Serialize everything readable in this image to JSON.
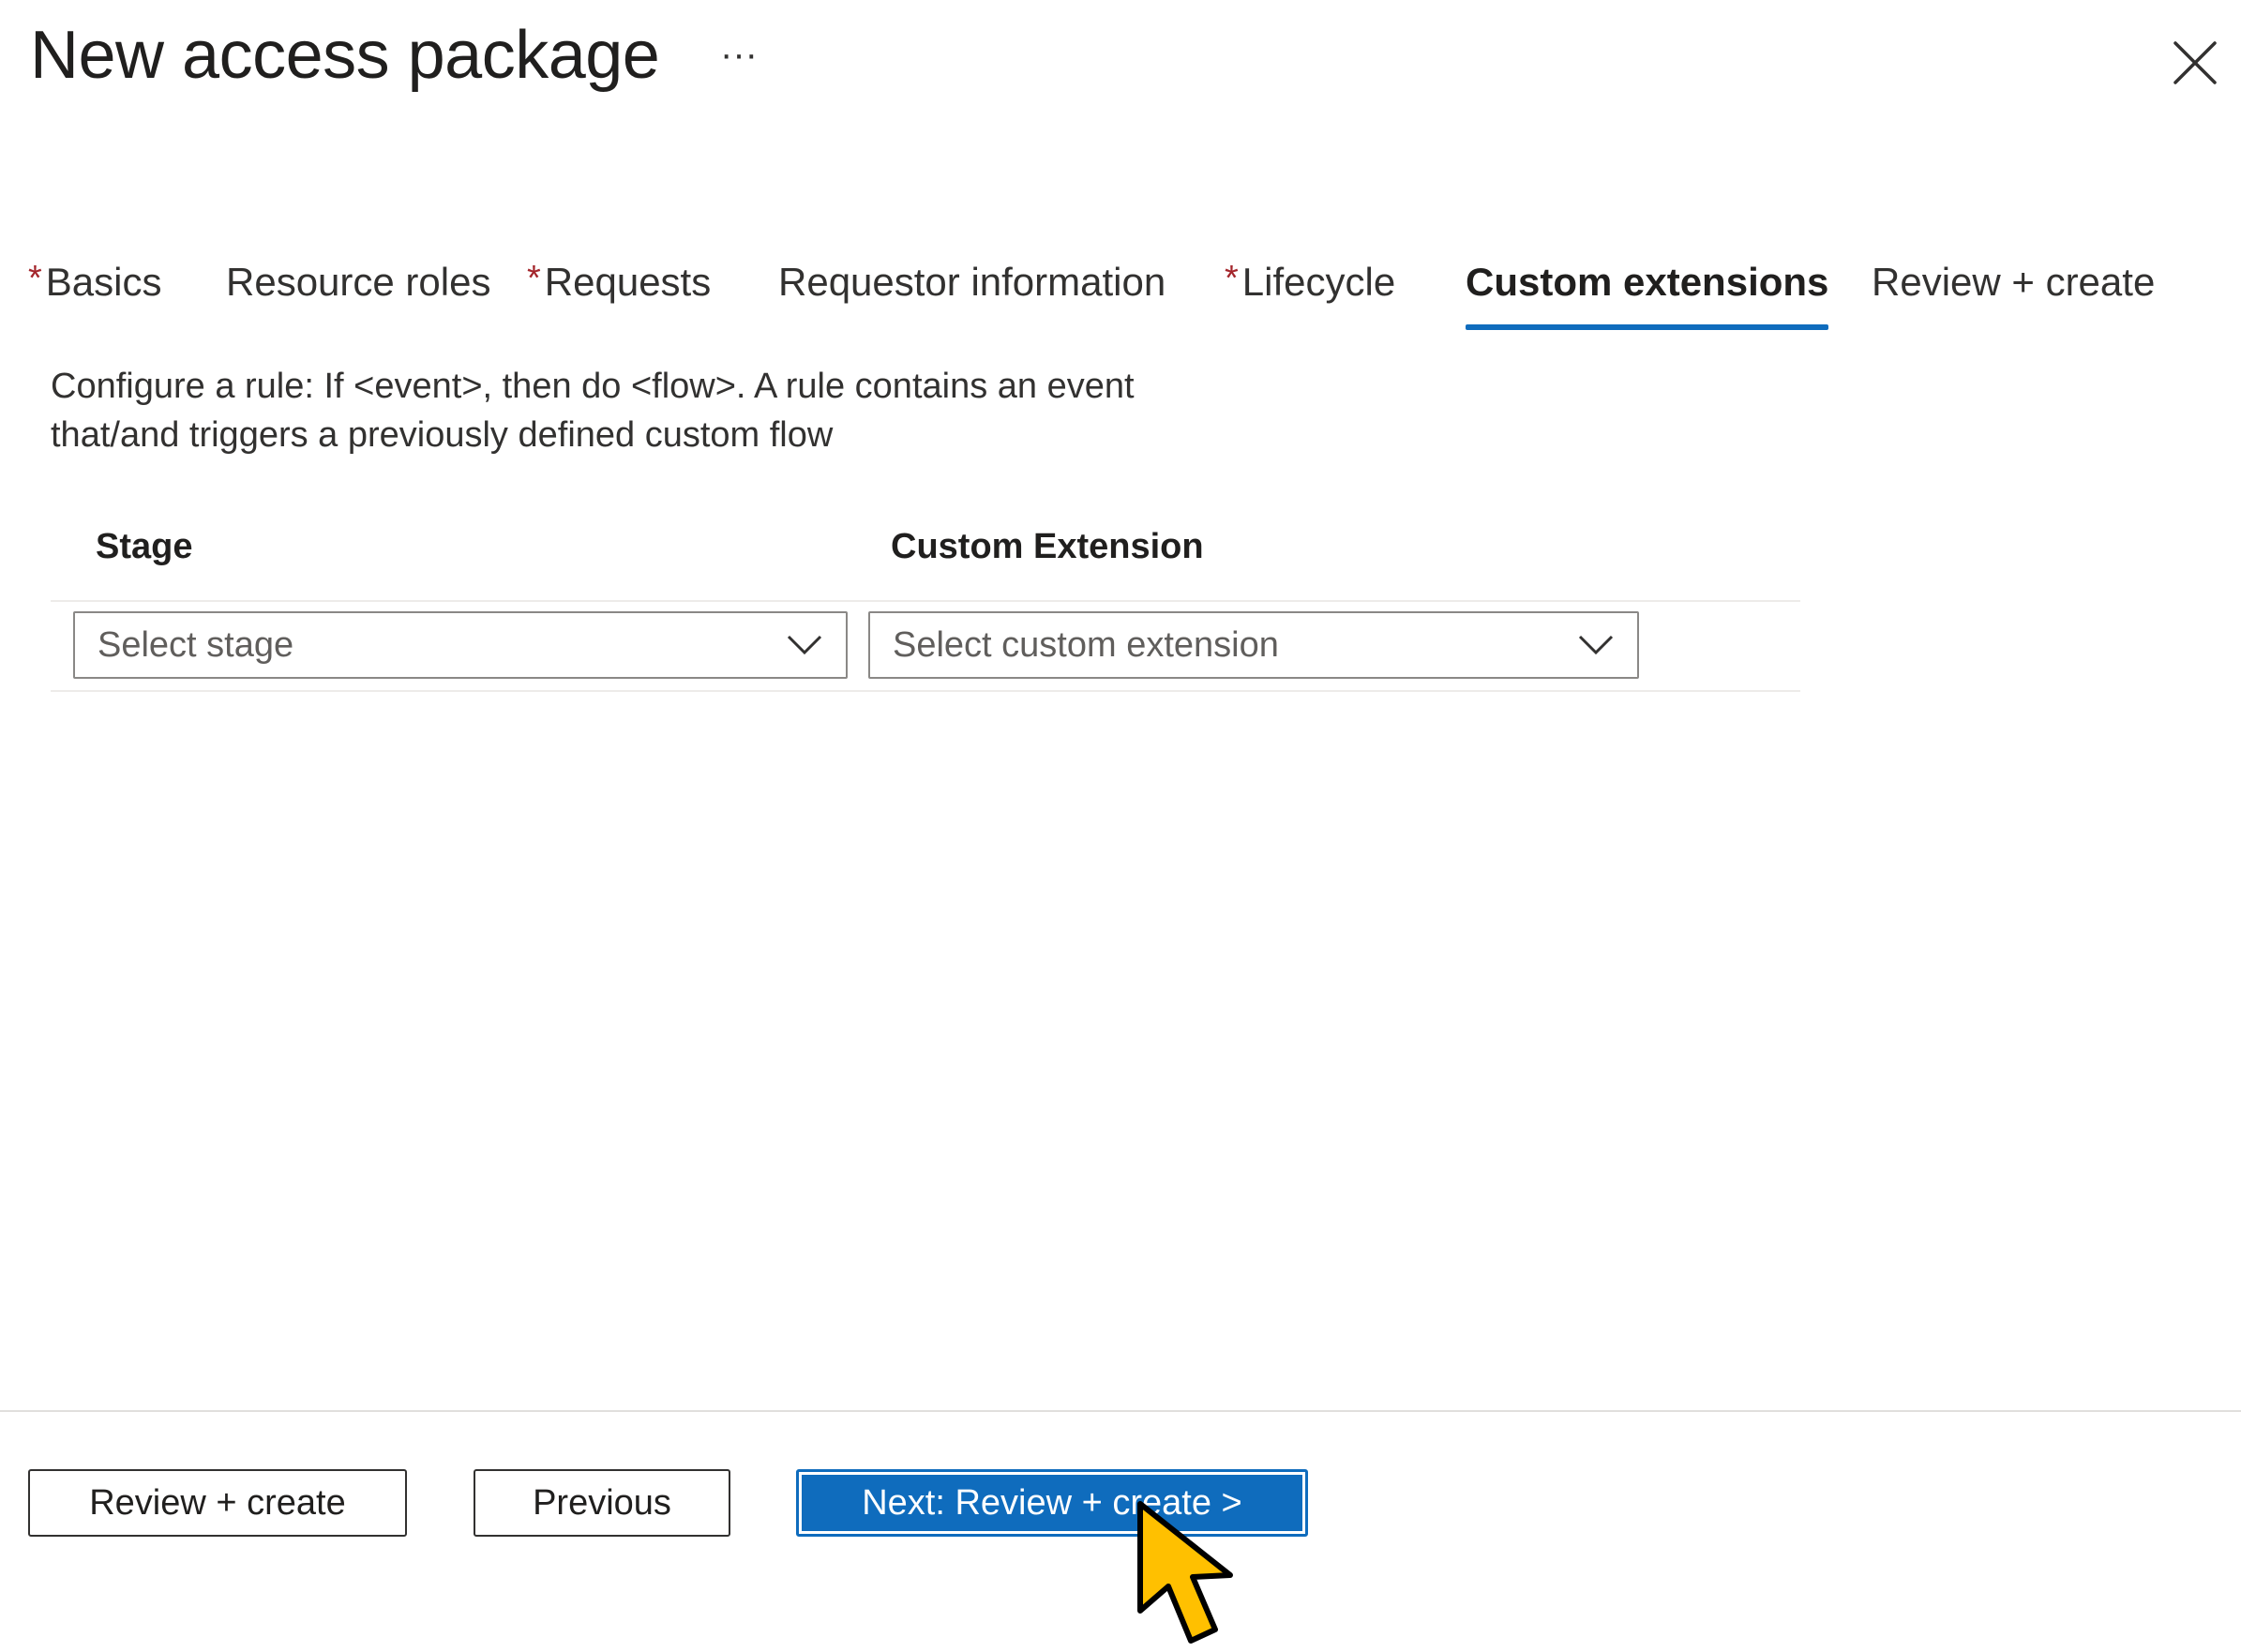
{
  "header": {
    "title": "New access package",
    "more_label": "···"
  },
  "tabs": [
    {
      "label": "Basics",
      "required": true,
      "active": false
    },
    {
      "label": "Resource roles",
      "required": false,
      "active": false
    },
    {
      "label": "Requests",
      "required": true,
      "active": false
    },
    {
      "label": "Requestor information",
      "required": false,
      "active": false
    },
    {
      "label": "Lifecycle",
      "required": true,
      "active": false
    },
    {
      "label": "Custom extensions",
      "required": false,
      "active": true
    },
    {
      "label": "Review + create",
      "required": false,
      "active": false
    }
  ],
  "required_marker": "*",
  "description": "Configure a rule: If <event>, then do <flow>. A rule contains an event that/and triggers a previously defined custom flow",
  "grid": {
    "columns": [
      "Stage",
      "Custom Extension"
    ],
    "row": {
      "stage_placeholder": "Select stage",
      "extension_placeholder": "Select custom extension"
    }
  },
  "footer": {
    "review_create_label": "Review + create",
    "previous_label": "Previous",
    "next_label": "Next: Review + create >"
  },
  "colors": {
    "accent": "#0f6cbd",
    "required": "#a4262c",
    "cursor_fill": "#ffc000"
  },
  "icons": {
    "more": "more-horizontal-icon",
    "close": "close-icon",
    "dropdown": "chevron-down-icon",
    "pointer": "mouse-pointer-icon"
  }
}
